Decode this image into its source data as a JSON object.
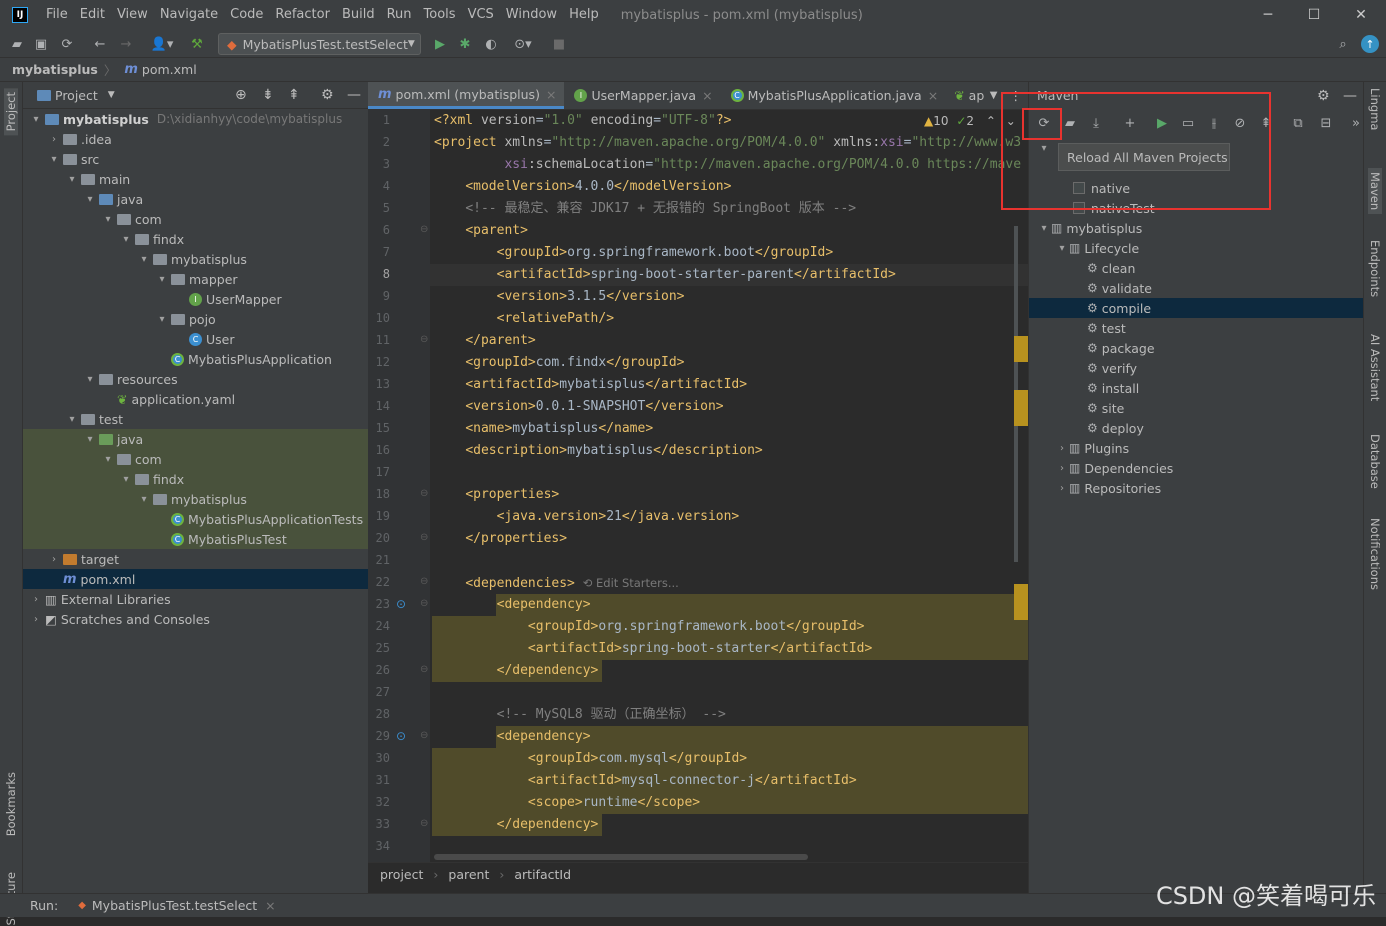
{
  "menubar": {
    "logo": "IJ",
    "items": [
      "File",
      "Edit",
      "View",
      "Navigate",
      "Code",
      "Refactor",
      "Build",
      "Run",
      "Tools",
      "VCS",
      "Window",
      "Help"
    ],
    "title": "mybatisplus - pom.xml (mybatisplus)",
    "minimize": "─",
    "maximize": "☐",
    "close": "✕"
  },
  "toolbar": {
    "run_config": "MybatisPlusTest.testSelect"
  },
  "breadcrumb": {
    "project": "mybatisplus",
    "file": "pom.xml"
  },
  "left_stripe": {
    "project": "Project",
    "bookmarks": "Bookmarks",
    "structure": "Structure"
  },
  "project_panel": {
    "title": "Project",
    "tree": [
      {
        "label": "mybatisplus",
        "extra": "D:\\xidianhyy\\code\\mybatisplus",
        "bold": true
      },
      {
        "label": ".idea"
      },
      {
        "label": "src"
      },
      {
        "label": "main"
      },
      {
        "label": "java"
      },
      {
        "label": "com"
      },
      {
        "label": "findx"
      },
      {
        "label": "mybatisplus"
      },
      {
        "label": "mapper"
      },
      {
        "label": "UserMapper"
      },
      {
        "label": "pojo"
      },
      {
        "label": "User"
      },
      {
        "label": "MybatisPlusApplication"
      },
      {
        "label": "resources"
      },
      {
        "label": "application.yaml"
      },
      {
        "label": "test"
      },
      {
        "label": "java"
      },
      {
        "label": "com"
      },
      {
        "label": "findx"
      },
      {
        "label": "mybatisplus"
      },
      {
        "label": "MybatisPlusApplicationTests"
      },
      {
        "label": "MybatisPlusTest"
      },
      {
        "label": "target"
      },
      {
        "label": "pom.xml"
      },
      {
        "label": "External Libraries"
      },
      {
        "label": "Scratches and Consoles"
      }
    ]
  },
  "editor": {
    "tabs": [
      "pom.xml (mybatisplus)",
      "UserMapper.java",
      "MybatisPlusApplication.java",
      "appli"
    ],
    "warnings": "10",
    "checks": "2",
    "edit_starters": "Edit Starters...",
    "status": [
      "project",
      "parent",
      "artifactId"
    ],
    "lines": [
      "1",
      "2",
      "3",
      "4",
      "5",
      "6",
      "7",
      "8",
      "9",
      "10",
      "11",
      "12",
      "13",
      "14",
      "15",
      "16",
      "17",
      "18",
      "19",
      "20",
      "21",
      "22",
      "23",
      "24",
      "25",
      "26",
      "27",
      "28",
      "29",
      "30",
      "31",
      "32",
      "33",
      "34"
    ]
  },
  "maven": {
    "title": "Maven",
    "tooltip": "Reload All Maven Projects",
    "profiles": [
      "native",
      "nativeTest"
    ],
    "project": "mybatisplus",
    "lifecycle": "Lifecycle",
    "goals": [
      "clean",
      "validate",
      "compile",
      "test",
      "package",
      "verify",
      "install",
      "site",
      "deploy"
    ],
    "plugins": "Plugins",
    "dependencies": "Dependencies",
    "repositories": "Repositories"
  },
  "right_stripe": {
    "lingma": "Lingma",
    "maven": "Maven",
    "endpoints": "Endpoints",
    "ai": "AI Assistant",
    "database": "Database",
    "notifications": "Notifications"
  },
  "bottom": {
    "run_label": "Run:",
    "run_tab": "MybatisPlusTest.testSelect"
  },
  "watermark": "CSDN @笑着喝可乐"
}
